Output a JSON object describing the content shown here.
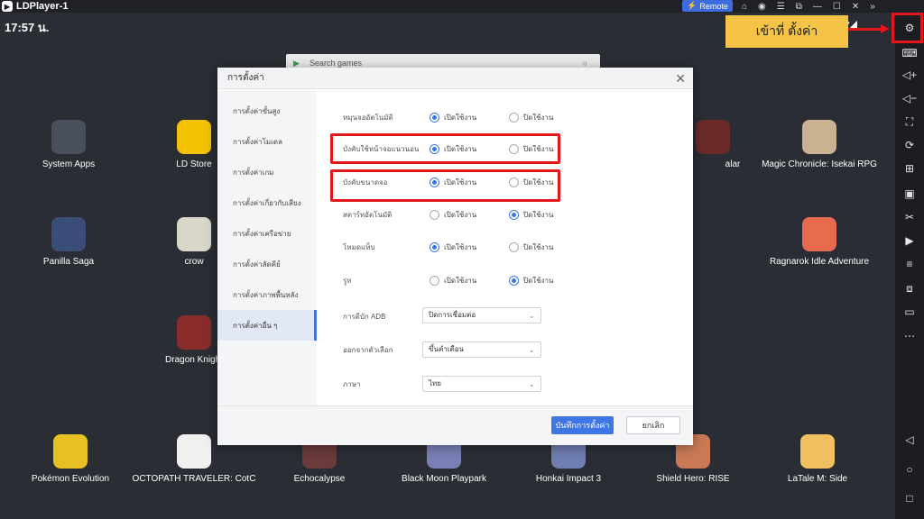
{
  "titlebar": {
    "title": "LDPlayer-1",
    "remote_label": "Remote"
  },
  "status": {
    "time": "17:57 น."
  },
  "callout": {
    "text": "เข้าที่ ตั้งค่า"
  },
  "search": {
    "placeholder": "Search games"
  },
  "apps": [
    {
      "label": "System Apps",
      "color": "#4a4f5c"
    },
    {
      "label": "LD Store",
      "color": "#f2c200"
    },
    {
      "label": "Panilla Saga",
      "color": "#3b4e7a"
    },
    {
      "label": "crow",
      "color": "#d8d6c8"
    },
    {
      "label": "Dragon Knight",
      "color": "#8a2b2b"
    },
    {
      "label": "Magic Chronicle: Isekai RPG",
      "color": "#c9b28f"
    },
    {
      "label": "Ragnarok Idle Adventure",
      "color": "#e66b4f"
    },
    {
      "label": "Pokémon Evolution",
      "color": "#e8c021"
    },
    {
      "label": "OCTOPATH TRAVELER: CotC",
      "color": "#f0f0f0"
    },
    {
      "label": "Echocalypse",
      "color": "#6b3a3a"
    },
    {
      "label": "Black Moon Playpark",
      "color": "#7a7fb5"
    },
    {
      "label": "Honkai Impact 3",
      "color": "#6f7db0"
    },
    {
      "label": "Shield Hero: RISE",
      "color": "#c97a55"
    },
    {
      "label": "LaTale M: Side",
      "color": "#f0c060"
    },
    {
      "label": "alar",
      "color": "#6a2a2a"
    }
  ],
  "dialog": {
    "title": "การตั้งค่า",
    "sidebar": [
      "การตั้งค่าขั้นสูง",
      "การตั้งค่าโมเดล",
      "การตั้งค่าเกม",
      "การตั้งค่าเกี่ยวกับเสียง",
      "การตั้งค่าเครือข่าย",
      "การตั้งค่าลัดคีย์",
      "การตั้งค่าภาพพื้นหลัง",
      "การตั้งค่าอื่น ๆ"
    ],
    "on_label": "เปิดใช้งาน",
    "off_label": "ปิดใช้งาน",
    "rows": [
      {
        "label": "หมุนจออัตโนมัติ",
        "selected": "on"
      },
      {
        "label": "บังคับใช้หน้าจอแนวนอน",
        "selected": "on"
      },
      {
        "label": "บังคับขนาดจอ",
        "selected": "on"
      },
      {
        "label": "สตาร์ทอัตโนมัติ",
        "selected": "off"
      },
      {
        "label": "โหมดแท็บ",
        "selected": "on"
      },
      {
        "label": "รูท",
        "selected": "off"
      }
    ],
    "selects": [
      {
        "label": "การดีบัก ADB",
        "value": "ปิดการเชื่อมต่อ"
      },
      {
        "label": "ออกจากตัวเลือก",
        "value": "ขึ้นคำเตือน"
      },
      {
        "label": "ภาษา",
        "value": "ไทย"
      }
    ],
    "save_label": "บันทึกการตั้งค่า",
    "cancel_label": "ยกเลิก"
  }
}
